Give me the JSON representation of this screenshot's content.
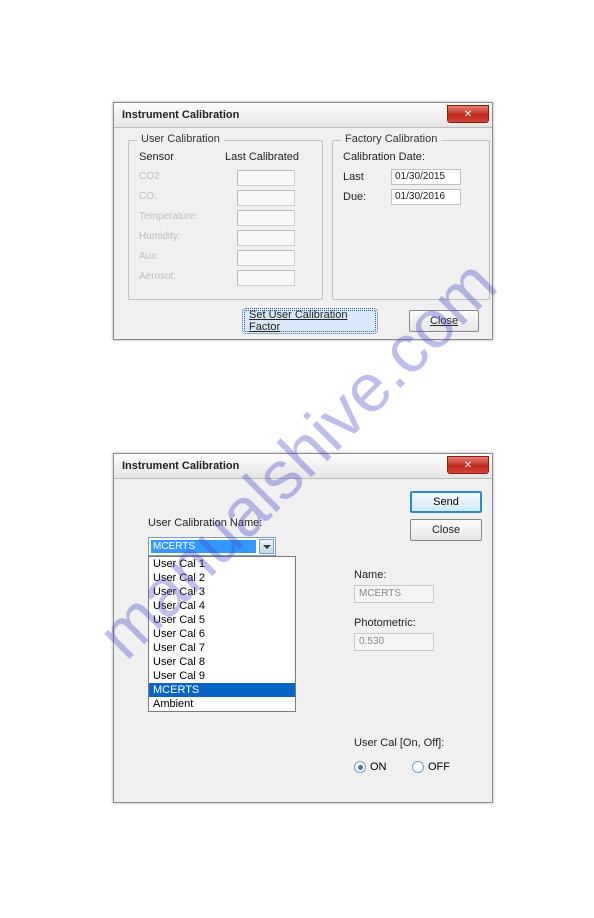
{
  "watermark": "manualshive.com",
  "dialog1": {
    "title": "Instrument Calibration",
    "user_cal": {
      "group_title": "User Calibration",
      "col_sensor": "Sensor",
      "col_last": "Last Calibrated",
      "sensors": {
        "co2": "CO2",
        "co": "CO:",
        "temperature": "Temperature:",
        "humidity": "Humidity:",
        "aux": "Aux:",
        "aerosol": "Aerosol:"
      }
    },
    "factory_cal": {
      "group_title": "Factory Calibration",
      "date_label": "Calibration Date:",
      "last_label": "Last",
      "last_value": "01/30/2015",
      "due_label": "Due:",
      "due_value": "01/30/2016"
    },
    "set_button": "Set User Calibration Factor",
    "close_button": "Close"
  },
  "dialog2": {
    "title": "Instrument Calibration",
    "send_button": "Send",
    "close_button": "Close",
    "cal_name_label": "User Calibration Name:",
    "combo_value": "MCERTS",
    "dropdown": [
      "User Cal 1",
      "User Cal 2",
      "User Cal 3",
      "User Cal 4",
      "User Cal 5",
      "User Cal 6",
      "User Cal 7",
      "User Cal 8",
      "User Cal 9",
      "MCERTS",
      "Ambient"
    ],
    "name_label": "Name:",
    "name_value": "MCERTS",
    "photometric_label": "Photometric:",
    "photometric_value": "0.530",
    "usercal_onoff_label": "User Cal [On, Off]:",
    "on_label": "ON",
    "off_label": "OFF",
    "radio_state": "on"
  }
}
